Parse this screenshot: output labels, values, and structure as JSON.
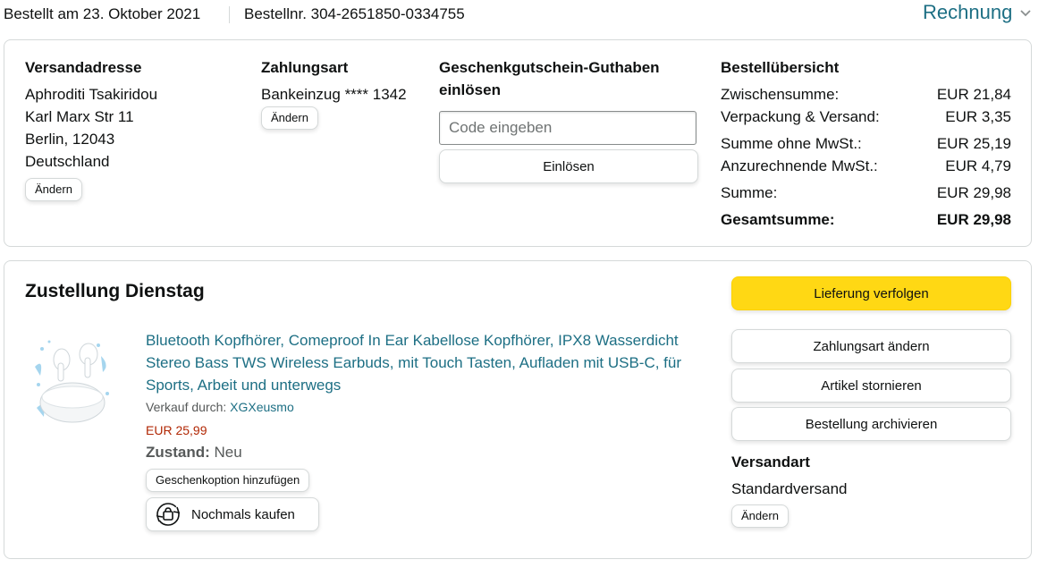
{
  "header": {
    "order_date": "Bestellt am 23. Oktober 2021",
    "order_number": "Bestellnr. 304-2651850-0334755",
    "invoice_label": "Rechnung"
  },
  "shipping_address": {
    "title": "Versandadresse",
    "lines": [
      "Aphroditi Tsakiridou",
      "Karl Marx Str 11",
      "Berlin, 12043",
      "Deutschland"
    ],
    "change_label": "Ändern"
  },
  "payment": {
    "title": "Zahlungsart",
    "method": "Bankeinzug **** 1342",
    "change_label": "Ändern"
  },
  "gift_card": {
    "title_line1": "Geschenkgutschein-Guthaben",
    "title_line2": "einlösen",
    "placeholder": "Code eingeben",
    "redeem_label": "Einlösen"
  },
  "summary": {
    "title": "Bestellübersicht",
    "rows": [
      {
        "label": "Zwischensumme:",
        "value": "EUR 21,84"
      },
      {
        "label": "Verpackung & Versand:",
        "value": "EUR 3,35"
      },
      {
        "label": "Summe ohne MwSt.:",
        "value": "EUR 25,19"
      },
      {
        "label": "Anzurechnende MwSt.:",
        "value": "EUR 4,79"
      },
      {
        "label": "Summe:",
        "value": "EUR 29,98"
      },
      {
        "label": "Gesamtsumme:",
        "value": "EUR 29,98"
      }
    ]
  },
  "delivery": {
    "title": "Zustellung Dienstag",
    "product": {
      "title": "Bluetooth Kopfhörer, Comeproof In Ear Kabellose Kopfhörer, IPX8 Wasserdicht Stereo Bass TWS Wireless Earbuds, mit Touch Tasten, Aufladen mit USB-C, für Sports, Arbeit und unterwegs",
      "seller_prefix": "Verkauf durch:",
      "seller": "XGXeusmo",
      "price": "EUR 25,99",
      "condition_label": "Zustand:",
      "condition": "Neu",
      "gift_option_label": "Geschenkoption hinzufügen",
      "buy_again_label": "Nochmals kaufen"
    },
    "actions": {
      "track": "Lieferung verfolgen",
      "change_payment": "Zahlungsart ändern",
      "cancel": "Artikel stornieren",
      "archive": "Bestellung archivieren"
    },
    "shipping_method": {
      "title": "Versandart",
      "value": "Standardversand",
      "change_label": "Ändern"
    }
  },
  "colors": {
    "link": "#1d6f84",
    "price": "#b12704",
    "primary_button": "#ffd814",
    "border": "#d5d9d9"
  }
}
